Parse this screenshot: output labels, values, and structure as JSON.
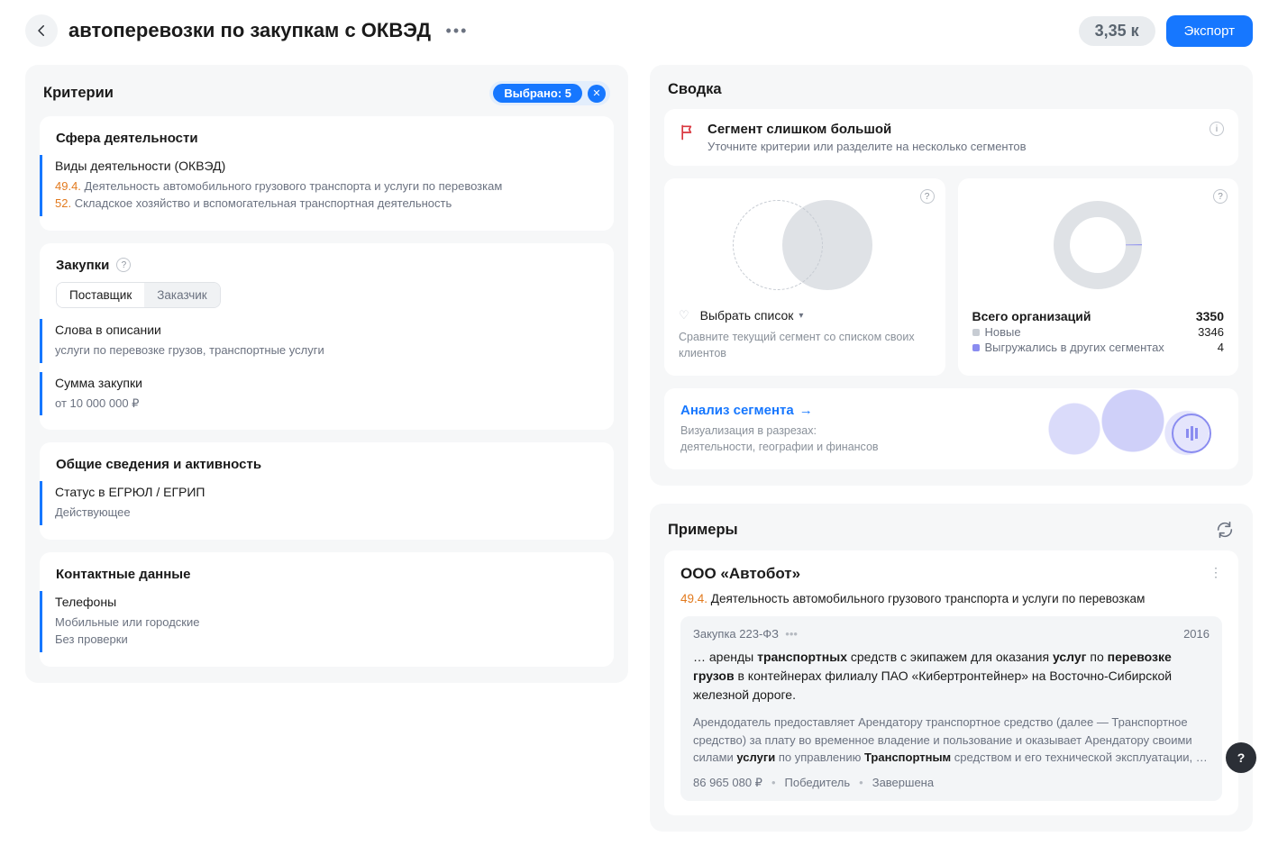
{
  "header": {
    "title": "автоперевозки по закупкам с ОКВЭД",
    "count": "3,35 к",
    "export": "Экспорт"
  },
  "criteria": {
    "title": "Критерии",
    "selected_chip": "Выбрано: 5",
    "groups": [
      {
        "title": "Сфера деятельности",
        "items": [
          {
            "title": "Виды деятельности (ОКВЭД)",
            "lines": [
              {
                "code": "49.4.",
                "text": "Деятельность автомобильного грузового транспорта и услуги по перевозкам"
              },
              {
                "code": "52.",
                "text": "Складское хозяйство и вспомогательная транспортная деятельность"
              }
            ]
          }
        ]
      },
      {
        "title": "Закупки",
        "help": true,
        "toggle": {
          "options": [
            "Поставщик",
            "Заказчик"
          ],
          "active": 0
        },
        "items": [
          {
            "title": "Слова в описании",
            "lines": [
              {
                "text": "услуги по перевозке грузов, транспортные услуги"
              }
            ]
          },
          {
            "title": "Сумма закупки",
            "lines": [
              {
                "text": "от 10 000 000 ₽"
              }
            ]
          }
        ]
      },
      {
        "title": "Общие сведения и активность",
        "items": [
          {
            "title": "Статус в ЕГРЮЛ / ЕГРИП",
            "lines": [
              {
                "text": "Действующее"
              }
            ]
          }
        ]
      },
      {
        "title": "Контактные данные",
        "items": [
          {
            "title": "Телефоны",
            "lines": [
              {
                "text": "Мобильные или городские"
              },
              {
                "text": "Без проверки"
              }
            ]
          }
        ]
      }
    ]
  },
  "summary": {
    "title": "Сводка",
    "alert": {
      "title": "Сегмент слишком большой",
      "sub": "Уточните критерии или разделите на несколько сегментов"
    },
    "compare": {
      "select_label": "Выбрать список",
      "hint": "Сравните текущий сегмент со списком своих клиентов"
    },
    "totals": {
      "total_label": "Всего организаций",
      "total_value": "3350",
      "new_label": "Новые",
      "new_value": "3346",
      "exported_label": "Выгружались в других сегментах",
      "exported_value": "4"
    },
    "analysis": {
      "link": "Анализ сегмента",
      "sub1": "Визуализация в разрезах:",
      "sub2": "деятельности, географии и финансов"
    }
  },
  "chart_data": {
    "type": "pie",
    "title": "Всего организаций",
    "series": [
      {
        "name": "Новые",
        "value": 3346,
        "color": "#c7ccd3"
      },
      {
        "name": "Выгружались в других сегментах",
        "value": 4,
        "color": "#8a8cf0"
      }
    ],
    "total": 3350
  },
  "examples": {
    "title": "Примеры",
    "company": "ООО «Автобот»",
    "okved_code": "49.4.",
    "okved_text": "Деятельность автомобильного грузового транспорта и услуги по перевозкам",
    "purchase": {
      "tag": "Закупка 223-ФЗ",
      "year": "2016",
      "title_pre": "… аренды ",
      "title_b1": "транспортных",
      "title_mid1": " средств с экипажем для оказания ",
      "title_b2": "услуг",
      "title_mid2": " по ",
      "title_b3": "перевозке грузов",
      "title_post": " в контейнерах филиалу ПАО «Кибертронтейнер» на Восточно-Сибирской железной дороге.",
      "desc_pre": "Арендодатель предоставляет Арендатору транспортное средство (далее — Транспортное средство) за плату во временное владение и пользование и оказывает Арендатору своими силами ",
      "desc_b1": "услуги",
      "desc_mid": " по управлению ",
      "desc_b2": "Транспортным",
      "desc_post": " средством и его технической эксплуатации, …",
      "amount": "86 965 080 ₽",
      "role": "Победитель",
      "status": "Завершена"
    }
  }
}
